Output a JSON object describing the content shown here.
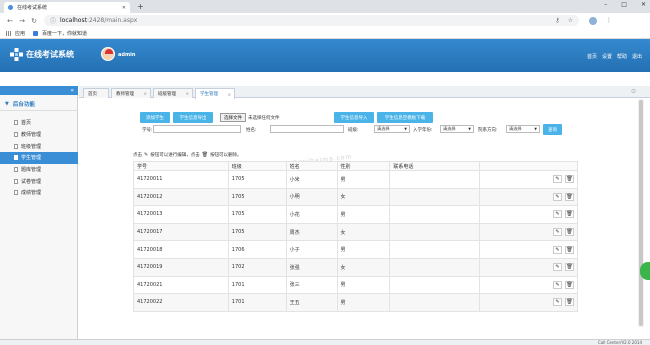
{
  "browser": {
    "tab_title": "在线考试系统",
    "url_host": "localhost",
    "url_path": ":2428/main.aspx",
    "bookmarks": [
      "应用",
      "百度一下，你就知道"
    ]
  },
  "header": {
    "app_title": "在线考试系统",
    "user_name": "admin",
    "links": [
      "首页",
      "设置",
      "帮助",
      "退出"
    ]
  },
  "sidebar": {
    "group_label": "后台功能",
    "items": [
      "首页",
      "教师管理",
      "班级管理",
      "学生管理",
      "题库管理",
      "试卷管理",
      "成绩管理"
    ],
    "active_index": 3
  },
  "tabs": [
    "首页",
    "教师管理",
    "班级管理",
    "学生管理"
  ],
  "toolbar": {
    "add_student": "添加学生",
    "export_student": "学生信息导出",
    "choose_file": "选择文件",
    "file_status": "未选择任何文件",
    "import_student": "学生信息导入",
    "download_template": "学生信息空模板下载",
    "search": "查询"
  },
  "filters": {
    "student_no_label": "学号:",
    "name_label": "姓名:",
    "class_label": "班级:",
    "class_value": "请选择",
    "year_label": "入学年份:",
    "year_value": "请选择",
    "major_label": "院系方向:",
    "major_value": "请选择"
  },
  "hint": {
    "prefix": "点击",
    "middle": "按钮可以进行编辑，点击",
    "suffix": "按钮可以删除。"
  },
  "watermark": "www.yoashangan@zuihaima.com",
  "table": {
    "headers": [
      "学号",
      "班级",
      "姓名",
      "性别",
      "联系电话",
      ""
    ],
    "rows": [
      [
        "41720011",
        "1705",
        "小米",
        "男",
        ""
      ],
      [
        "41720012",
        "1705",
        "小明",
        "女",
        ""
      ],
      [
        "41720013",
        "1705",
        "小花",
        "男",
        ""
      ],
      [
        "41720017",
        "1705",
        "周杰",
        "女",
        ""
      ],
      [
        "41720018",
        "1706",
        "小子",
        "男",
        ""
      ],
      [
        "41720019",
        "1702",
        "张强",
        "女",
        ""
      ],
      [
        "41720021",
        "1701",
        "张三",
        "男",
        ""
      ],
      [
        "41720022",
        "1701",
        "王五",
        "男",
        ""
      ]
    ]
  },
  "footer": "Call Center/V2.0 2014"
}
